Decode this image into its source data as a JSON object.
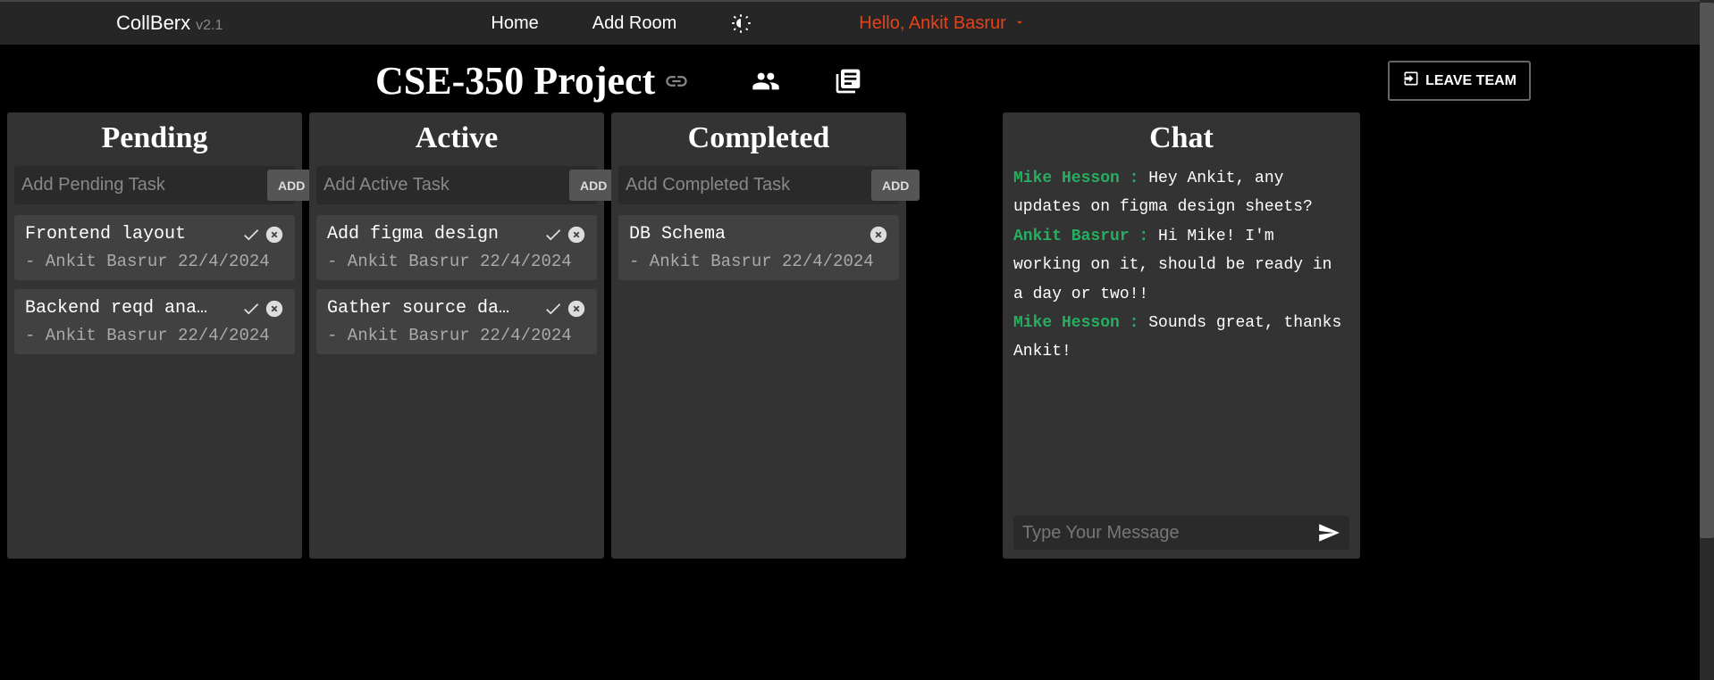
{
  "brand": {
    "name": "CollBerx",
    "version": "v2.1"
  },
  "nav": {
    "home": "Home",
    "add_room": "Add Room",
    "greeting": "Hello, Ankit Basrur"
  },
  "project": {
    "title": "CSE-350 Project"
  },
  "leave_team_label": "LEAVE TEAM",
  "columns": [
    {
      "title": "Pending",
      "placeholder": "Add Pending Task",
      "add_label": "ADD",
      "tasks": [
        {
          "title": "Frontend layout",
          "meta": "- Ankit Basrur 22/4/2024",
          "has_check": true
        },
        {
          "title": "Backend reqd analy…",
          "meta": "- Ankit Basrur 22/4/2024",
          "has_check": true
        }
      ]
    },
    {
      "title": "Active",
      "placeholder": "Add Active Task",
      "add_label": "ADD",
      "tasks": [
        {
          "title": "Add figma design",
          "meta": "- Ankit Basrur 22/4/2024",
          "has_check": true
        },
        {
          "title": "Gather source data",
          "meta": "- Ankit Basrur 22/4/2024",
          "has_check": true
        }
      ]
    },
    {
      "title": "Completed",
      "placeholder": "Add Completed Task",
      "add_label": "ADD",
      "tasks": [
        {
          "title": "DB Schema",
          "meta": "- Ankit Basrur 22/4/2024",
          "has_check": false
        }
      ]
    }
  ],
  "chat": {
    "title": "Chat",
    "placeholder": "Type Your Message",
    "messages": [
      {
        "sender": "Mike Hesson :",
        "text": "Hey Ankit, any updates on figma design sheets?"
      },
      {
        "sender": "Ankit Basrur :",
        "text": "Hi Mike! I'm working on it, should be ready in a day or two!!"
      },
      {
        "sender": "Mike Hesson :",
        "text": "Sounds great, thanks Ankit!"
      }
    ]
  }
}
